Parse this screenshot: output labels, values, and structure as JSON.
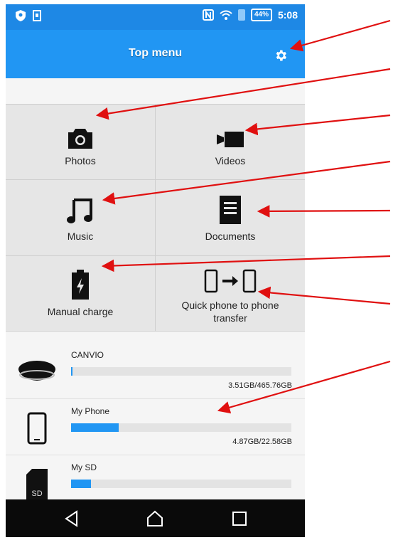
{
  "status_bar": {
    "battery": "44%",
    "time": "5:08",
    "icons": [
      "shield-icon",
      "sim-icon",
      "nfc-icon",
      "wifi-icon",
      "bluetooth-icon",
      "battery-icon"
    ]
  },
  "header": {
    "title": "Top menu",
    "settings_icon": "gear-icon"
  },
  "menu": {
    "items": [
      {
        "label": "Photos",
        "icon": "camera-icon"
      },
      {
        "label": "Videos",
        "icon": "video-camera-icon"
      },
      {
        "label": "Music",
        "icon": "music-note-icon"
      },
      {
        "label": "Documents",
        "icon": "document-icon"
      },
      {
        "label": "Manual charge",
        "icon": "battery-charge-icon"
      },
      {
        "label": "Quick phone to phone transfer",
        "icon": "phone-transfer-icon"
      }
    ]
  },
  "storage": [
    {
      "name": "CANVIO",
      "size": "3.51GB/465.76GB",
      "usage_fraction": 0.008,
      "icon": "external-drive-icon"
    },
    {
      "name": "My Phone",
      "size": "4.87GB/22.58GB",
      "usage_fraction": 0.216,
      "icon": "smartphone-icon"
    },
    {
      "name": "My SD",
      "size": "",
      "usage_fraction": 0.09,
      "icon": "sd-card-icon"
    }
  ],
  "sd_icon_text": "SD",
  "nav": [
    "back-icon",
    "home-icon",
    "recents-icon"
  ],
  "colors": {
    "accent": "#2196f3",
    "status_bar": "#1e88e5",
    "annotation_arrow": "#e01010"
  }
}
